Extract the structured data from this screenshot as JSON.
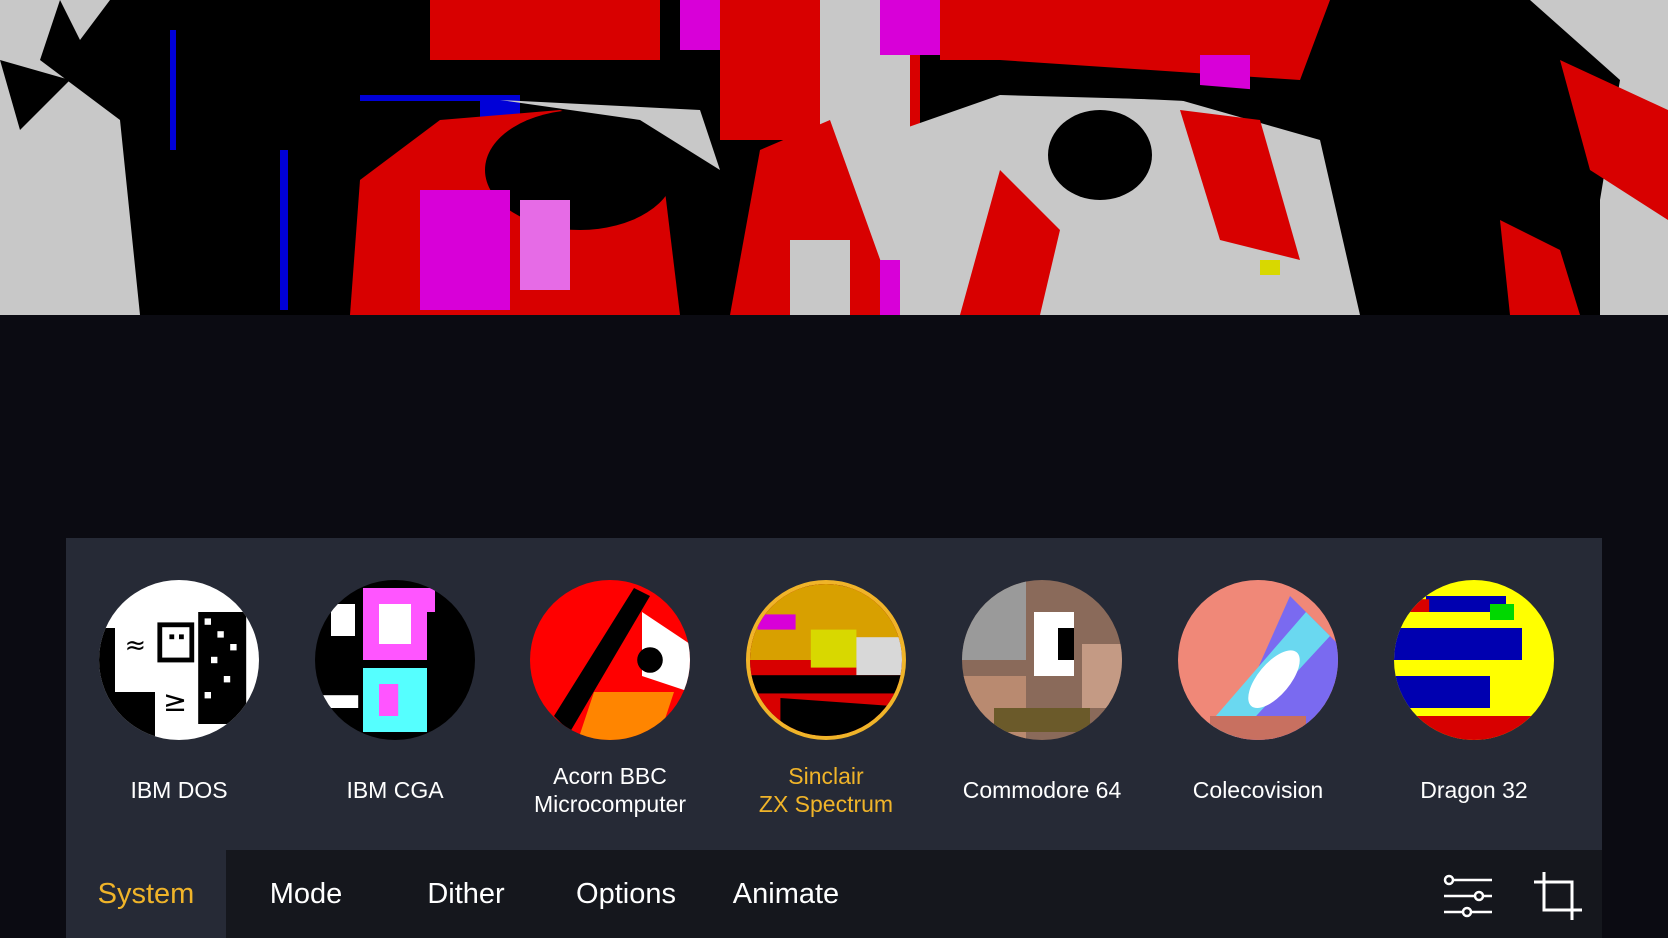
{
  "preview": {
    "image": "pixel-art-dithered-face-preview"
  },
  "systems": [
    {
      "lines": [
        "IBM DOS"
      ],
      "selected": false,
      "thumb": "ibm-dos-thumbnail"
    },
    {
      "lines": [
        "IBM CGA"
      ],
      "selected": false,
      "thumb": "ibm-cga-thumbnail"
    },
    {
      "lines": [
        "Acorn BBC",
        "Microcomputer"
      ],
      "selected": false,
      "thumb": "acorn-bbc-thumbnail"
    },
    {
      "lines": [
        "Sinclair",
        "ZX Spectrum"
      ],
      "selected": true,
      "thumb": "zx-spectrum-thumbnail"
    },
    {
      "lines": [
        "Commodore 64"
      ],
      "selected": false,
      "thumb": "commodore-64-thumbnail"
    },
    {
      "lines": [
        "Colecovision"
      ],
      "selected": false,
      "thumb": "colecovision-thumbnail"
    },
    {
      "lines": [
        "Dragon 32"
      ],
      "selected": false,
      "thumb": "dragon-32-thumbnail"
    }
  ],
  "tabs": [
    {
      "label": "System",
      "active": true
    },
    {
      "label": "Mode",
      "active": false
    },
    {
      "label": "Dither",
      "active": false
    },
    {
      "label": "Options",
      "active": false
    },
    {
      "label": "Animate",
      "active": false
    }
  ],
  "toolbar": {
    "adjust_icon": "sliders-icon",
    "crop_icon": "crop-icon"
  },
  "colors": {
    "accent": "#f0b429",
    "panel": "#262a36",
    "tabbar": "#15171d",
    "background": "#0b0b12"
  }
}
